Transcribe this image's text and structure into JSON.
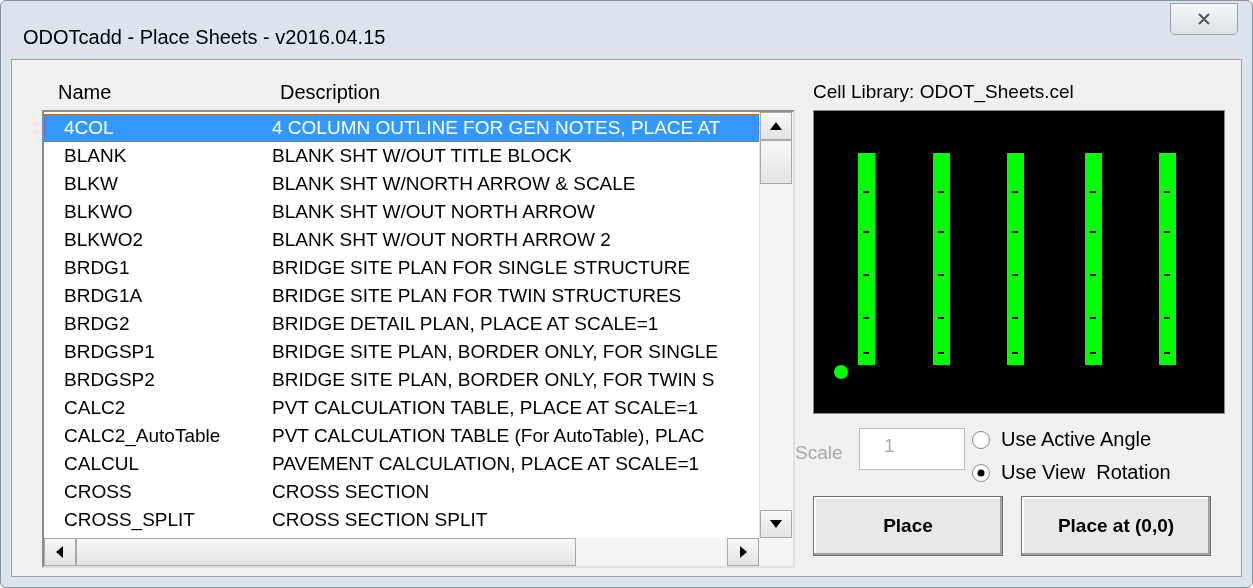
{
  "window": {
    "title": "ODOTcadd - Place Sheets - v2016.04.15"
  },
  "list": {
    "columns": [
      "Name",
      "Description"
    ],
    "rows": [
      {
        "name": "4COL",
        "description": "4 COLUMN OUTLINE FOR GEN NOTES, PLACE AT",
        "selected": true
      },
      {
        "name": "BLANK",
        "description": "BLANK SHT W/OUT TITLE BLOCK",
        "selected": false
      },
      {
        "name": "BLKW",
        "description": "BLANK SHT W/NORTH ARROW & SCALE",
        "selected": false
      },
      {
        "name": "BLKWO",
        "description": "BLANK SHT W/OUT NORTH ARROW",
        "selected": false
      },
      {
        "name": "BLKWO2",
        "description": "BLANK SHT W/OUT NORTH ARROW 2",
        "selected": false
      },
      {
        "name": "BRDG1",
        "description": "BRIDGE SITE PLAN FOR SINGLE STRUCTURE",
        "selected": false
      },
      {
        "name": "BRDG1A",
        "description": "BRIDGE SITE PLAN FOR TWIN STRUCTURES",
        "selected": false
      },
      {
        "name": "BRDG2",
        "description": "BRIDGE DETAIL PLAN, PLACE AT SCALE=1",
        "selected": false
      },
      {
        "name": "BRDGSP1",
        "description": "BRIDGE SITE PLAN, BORDER ONLY, FOR SINGLE",
        "selected": false
      },
      {
        "name": "BRDGSP2",
        "description": "BRIDGE SITE PLAN, BORDER ONLY, FOR TWIN S",
        "selected": false
      },
      {
        "name": "CALC2",
        "description": "PVT CALCULATION TABLE, PLACE AT SCALE=1",
        "selected": false
      },
      {
        "name": "CALC2_AutoTable",
        "description": "PVT CALCULATION TABLE (For AutoTable), PLAC",
        "selected": false
      },
      {
        "name": "CALCUL",
        "description": "PAVEMENT CALCULATION, PLACE AT SCALE=1",
        "selected": false
      },
      {
        "name": "CROSS",
        "description": "CROSS SECTION",
        "selected": false
      },
      {
        "name": "CROSS_SPLIT",
        "description": "CROSS SECTION SPLIT",
        "selected": false
      }
    ]
  },
  "cell_library": {
    "label": "Cell Library: ODOT_Sheets.cel"
  },
  "scale": {
    "label": "Scale",
    "value": "1",
    "disabled": true
  },
  "rotation_options": [
    {
      "label": "Use Active Angle",
      "selected": false
    },
    {
      "label": "Use View  Rotation",
      "selected": true
    }
  ],
  "buttons": [
    "Place",
    "Place at (0,0)"
  ]
}
